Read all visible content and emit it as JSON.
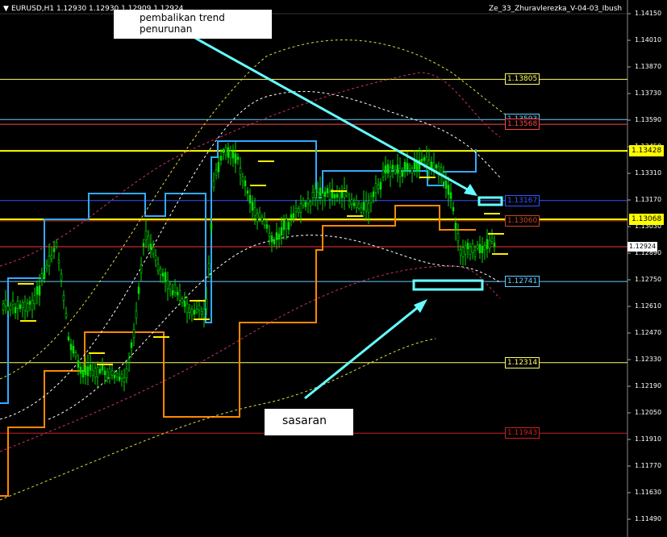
{
  "header": {
    "symbol_info": "EURUSD,H1  1.12930 1.12930 1.12909 1.12924",
    "indicator_name": "Ze_33_Zhuravlerezka_V-04-03_Ibush"
  },
  "axis": {
    "ticks": [
      "1.14150",
      "1.14010",
      "1.13870",
      "1.13730",
      "1.13590",
      "1.13450",
      "1.13310",
      "1.13170",
      "1.13030",
      "1.12890",
      "1.12750",
      "1.12610",
      "1.12470",
      "1.12330",
      "1.12190",
      "1.12050",
      "1.11910",
      "1.11770",
      "1.11630",
      "1.11490"
    ]
  },
  "levels": [
    {
      "value": "1.13805",
      "color": "#ffff66",
      "price": 1.13805
    },
    {
      "value": "1.13593",
      "color": "#66ccff",
      "price": 1.13593
    },
    {
      "value": "1.13568",
      "color": "#ff4444",
      "price": 1.13568
    },
    {
      "value": "1.13428",
      "color": "#ffff00",
      "price": 1.13428
    },
    {
      "value": "1.13167",
      "color": "#3355ff",
      "price": 1.13167
    },
    {
      "value": "1.13068",
      "color": "#ffff00",
      "price": 1.13068
    },
    {
      "value": "1.13060",
      "color": "#cc4422",
      "price": 1.1306
    },
    {
      "value": "1.12741",
      "color": "#66ccff",
      "price": 1.12741
    },
    {
      "value": "1.12314",
      "color": "#ffff66",
      "price": 1.12314
    },
    {
      "value": "1.11943",
      "color": "#cc2222",
      "price": 1.11943
    }
  ],
  "current_price": {
    "value": "1.12924",
    "price": 1.12924
  },
  "annotations": {
    "top_callout_line1": "pembalikan trend",
    "top_callout_line2": "penurunan",
    "bottom_callout": "sasaran"
  },
  "colors": {
    "candle": "#00dd00",
    "blue_step": "#33aaff",
    "orange_step": "#ff8800",
    "arrow": "#66ffff"
  }
}
